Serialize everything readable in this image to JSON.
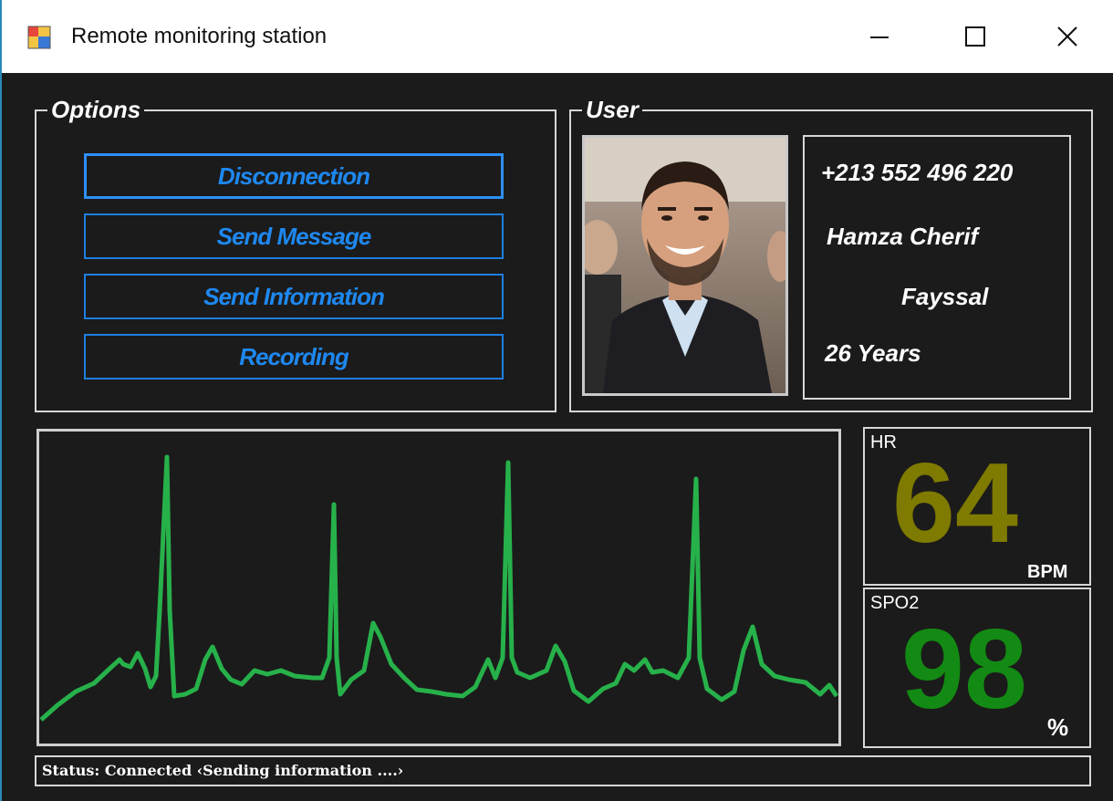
{
  "window": {
    "title": "Remote monitoring station",
    "icon": "app-window-icon"
  },
  "options": {
    "title": "Options",
    "buttons": [
      {
        "label": "Disconnection"
      },
      {
        "label": "Send Message"
      },
      {
        "label": "Send Information"
      },
      {
        "label": "Recording"
      }
    ]
  },
  "user": {
    "title": "User",
    "phone": "+213 552 496 220",
    "name_line1": "Hamza Cherif",
    "name_line2": "Fayssal",
    "age": "26 Years",
    "photo": "user-photo"
  },
  "vitals": {
    "hr": {
      "label": "HR",
      "value": "64",
      "unit": "BPM",
      "color": "#7f7a00"
    },
    "spo2": {
      "label": "SPO2",
      "value": "98",
      "unit": "%",
      "color": "#138a13"
    }
  },
  "ecg": {
    "color": "#27b14a"
  },
  "status": {
    "text": "Status:  Connected ‹Sending information ....›"
  },
  "colors": {
    "background": "#1b1b1b",
    "button_accent": "#1e88f0",
    "border": "#d7d7d7"
  }
}
